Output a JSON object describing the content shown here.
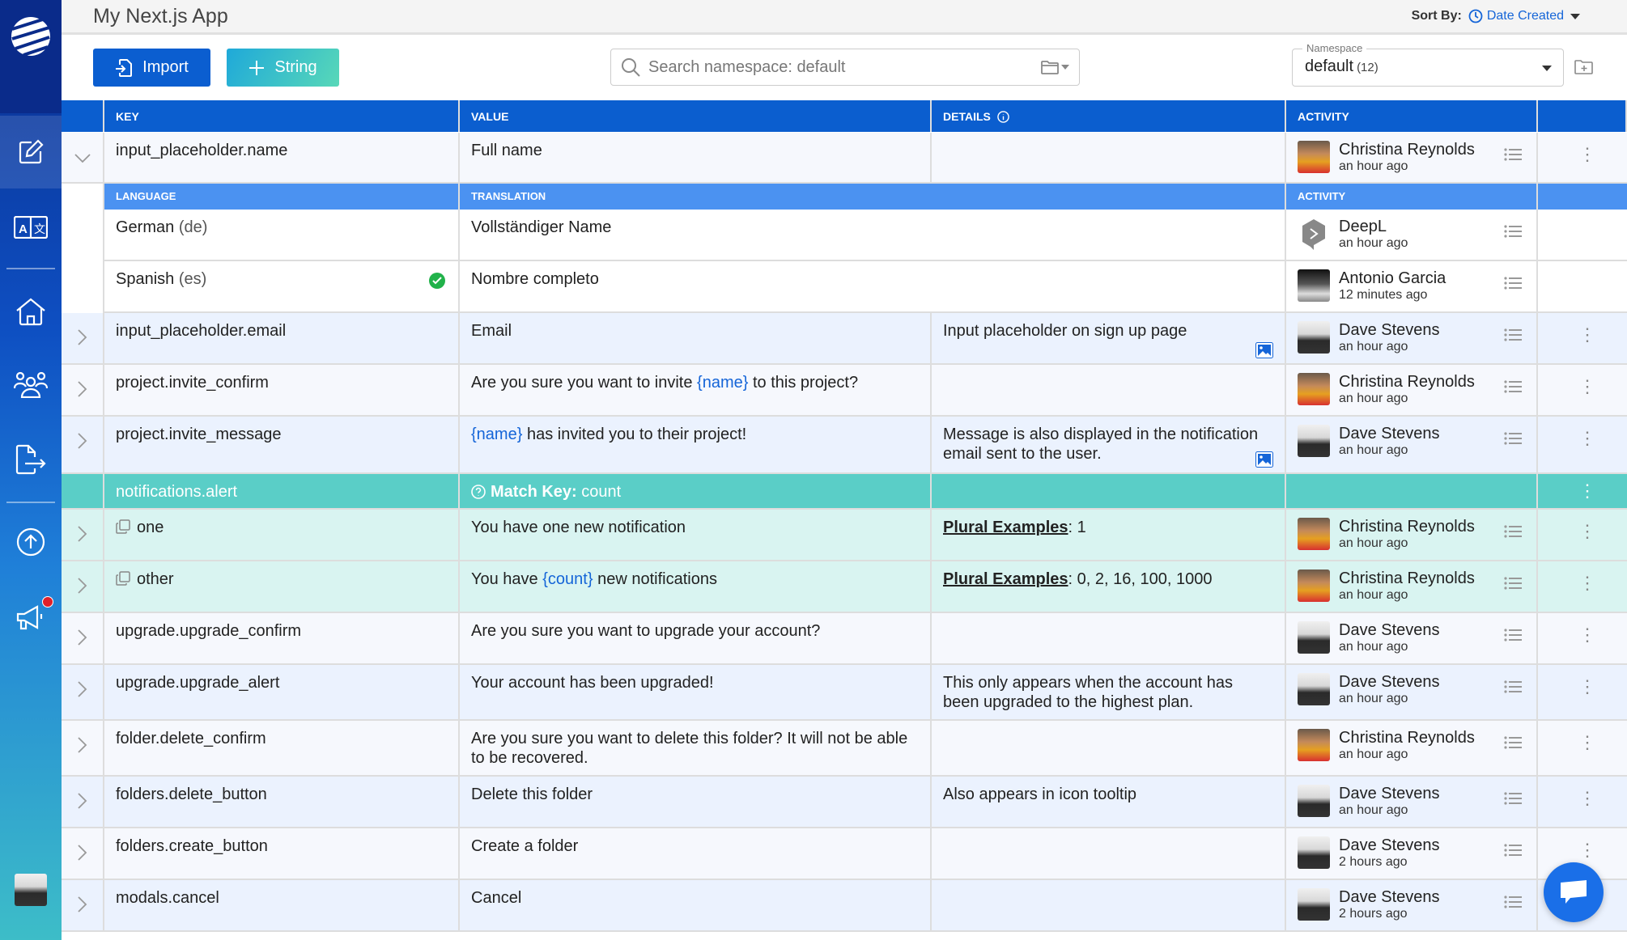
{
  "app": {
    "title": "My Next.js App"
  },
  "sort": {
    "label": "Sort By:",
    "value": "Date Created"
  },
  "toolbar": {
    "import_label": "Import",
    "string_label": "String"
  },
  "search": {
    "placeholder": "Search namespace: default"
  },
  "namespace": {
    "legend": "Namespace",
    "value": "default",
    "count": "(12)"
  },
  "columns": {
    "key": "KEY",
    "value": "VALUE",
    "details": "DETAILS",
    "activity": "ACTIVITY"
  },
  "sub_columns": {
    "language": "LANGUAGE",
    "translation": "TRANSLATION",
    "activity": "ACTIVITY"
  },
  "colors": {
    "primary": "#0b5ecf",
    "sub_header": "#4b92f1",
    "teal": "#5acec7",
    "teal_light": "#d9f4f1",
    "placeholder": "#1565d8",
    "badge": "#e0202a"
  },
  "rows": {
    "r1": {
      "key": "input_placeholder.name",
      "value": "Full name",
      "details": "",
      "user": "Christina Reynolds",
      "time": "an hour ago"
    },
    "de": {
      "language": "German",
      "code": "(de)",
      "translation": "Vollständiger Name",
      "user": "DeepL",
      "time": "an hour ago"
    },
    "es": {
      "language": "Spanish",
      "code": "(es)",
      "translation": "Nombre completo",
      "user": "Antonio Garcia",
      "time": "12 minutes ago",
      "verified": true
    },
    "r2": {
      "key": "input_placeholder.email",
      "value": "Email",
      "details": "Input placeholder on sign up page",
      "user": "Dave Stevens",
      "time": "an hour ago"
    },
    "r3": {
      "key": "project.invite_confirm",
      "value_pre": "Are you sure you want to invite ",
      "value_ph": "{name}",
      "value_post": " to this project?",
      "details": "",
      "user": "Christina Reynolds",
      "time": "an hour ago"
    },
    "r4": {
      "key": "project.invite_message",
      "value_ph": "{name}",
      "value_post": " has invited you to their project!",
      "details": "Message is also displayed in the notification email sent to the user.",
      "user": "Dave Stevens",
      "time": "an hour ago"
    },
    "plural": {
      "key": "notifications.alert",
      "match_label": "Match Key:",
      "match_value": "count"
    },
    "one": {
      "key": "one",
      "value": "You have one new notification",
      "plural_label": "Plural Examples",
      "plural_values": ": 1",
      "user": "Christina Reynolds",
      "time": "an hour ago"
    },
    "other": {
      "key": "other",
      "value_pre": "You have ",
      "value_ph": "{count}",
      "value_post": " new notifications",
      "plural_label": "Plural Examples",
      "plural_values": ": 0, 2, 16, 100, 1000",
      "user": "Christina Reynolds",
      "time": "an hour ago"
    },
    "r5": {
      "key": "upgrade.upgrade_confirm",
      "value": "Are you sure you want to upgrade your account?",
      "details": "",
      "user": "Dave Stevens",
      "time": "an hour ago"
    },
    "r6": {
      "key": "upgrade.upgrade_alert",
      "value": "Your account has been upgraded!",
      "details": "This only appears when the account has been upgraded to the highest plan.",
      "user": "Dave Stevens",
      "time": "an hour ago"
    },
    "r7": {
      "key": "folder.delete_confirm",
      "value": "Are you sure you want to delete this folder? It will not be able to be recovered.",
      "details": "",
      "user": "Christina Reynolds",
      "time": "an hour ago"
    },
    "r8": {
      "key": "folders.delete_button",
      "value": "Delete this folder",
      "details": "Also appears in icon tooltip",
      "user": "Dave Stevens",
      "time": "an hour ago"
    },
    "r9": {
      "key": "folders.create_button",
      "value": "Create a folder",
      "details": "",
      "user": "Dave Stevens",
      "time": "2 hours ago"
    },
    "r10": {
      "key": "modals.cancel",
      "value": "Cancel",
      "details": "",
      "user": "Dave Stevens",
      "time": "2 hours ago"
    }
  },
  "icons": {
    "kebab": "⋮",
    "chevron_right": "›",
    "chevron_down": "⌄"
  }
}
